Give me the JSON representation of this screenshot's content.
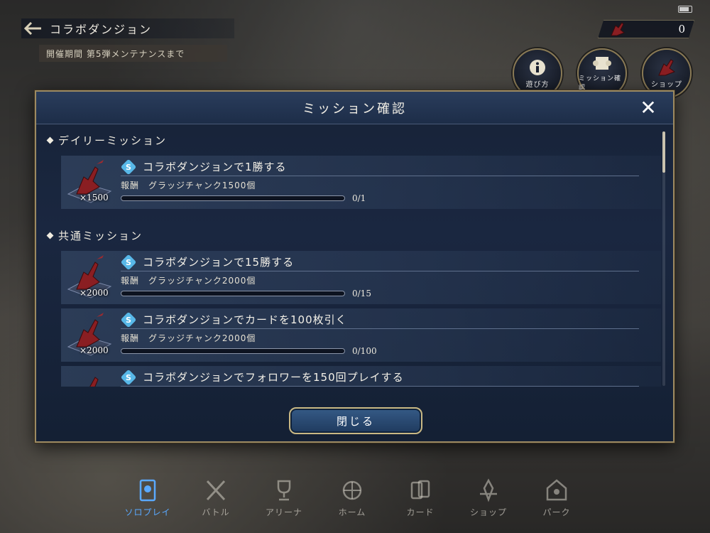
{
  "topbar": {
    "title": "コラボダンジョン",
    "period": "開催期間 第5弾メンテナンスまで",
    "currency_value": "0"
  },
  "round_buttons": [
    {
      "label": "遊び方",
      "icon": "info-icon"
    },
    {
      "label": "ミッション確認",
      "icon": "scroll-icon"
    },
    {
      "label": "ショップ",
      "icon": "shop-icon"
    }
  ],
  "modal": {
    "title": "ミッション確認",
    "close_button": "閉じる",
    "sections": [
      {
        "title": "デイリーミッション",
        "missions": [
          {
            "title": "コラボダンジョンで1勝する",
            "reward": "報酬　グラッジチャンク1500個",
            "quantity": "×1500",
            "progress": "0/1",
            "progress_fraction": 0
          }
        ]
      },
      {
        "title": "共通ミッション",
        "missions": [
          {
            "title": "コラボダンジョンで15勝する",
            "reward": "報酬　グラッジチャンク2000個",
            "quantity": "×2000",
            "progress": "0/15",
            "progress_fraction": 0
          },
          {
            "title": "コラボダンジョンでカードを100枚引く",
            "reward": "報酬　グラッジチャンク2000個",
            "quantity": "×2000",
            "progress": "0/100",
            "progress_fraction": 0
          },
          {
            "title": "コラボダンジョンでフォロワーを150回プレイする"
          }
        ]
      }
    ]
  },
  "bottom_nav": [
    {
      "label": "ソロプレイ",
      "icon": "solo-play-icon",
      "active": true
    },
    {
      "label": "バトル",
      "icon": "swords-icon",
      "active": false
    },
    {
      "label": "アリーナ",
      "icon": "trophy-icon",
      "active": false
    },
    {
      "label": "ホーム",
      "icon": "home-emblem-icon",
      "active": false
    },
    {
      "label": "カード",
      "icon": "cards-icon",
      "active": false
    },
    {
      "label": "ショップ",
      "icon": "shop-icon",
      "active": false
    },
    {
      "label": "パーク",
      "icon": "park-icon",
      "active": false
    }
  ],
  "colors": {
    "accent_gold": "#9c8a62",
    "active_nav": "#5aa9ff",
    "panel": "#1a2740"
  }
}
